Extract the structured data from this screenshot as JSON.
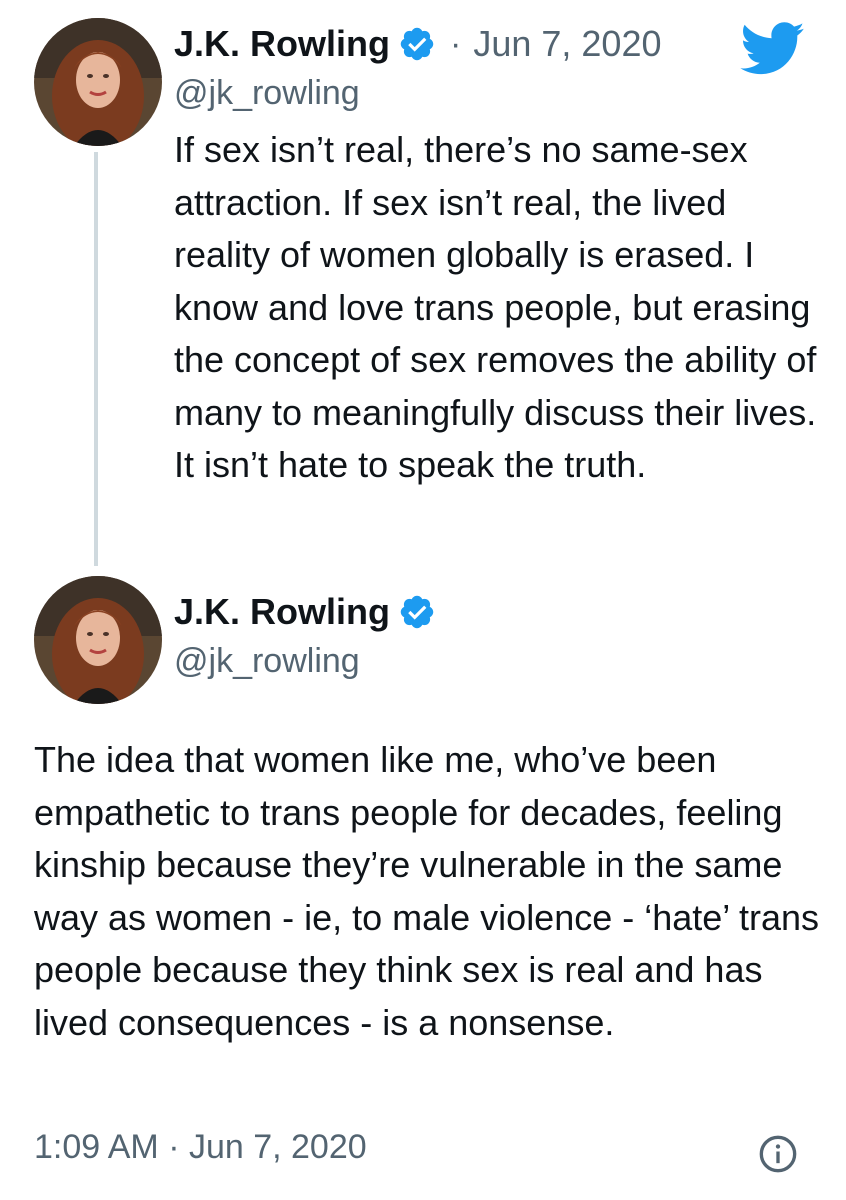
{
  "colors": {
    "accent": "#1d9bf0",
    "text_primary": "#0f1419",
    "text_secondary": "#536471",
    "thread_line": "#cfd9de"
  },
  "icons": {
    "twitter_logo": "twitter-bird-icon",
    "verified": "verified-badge-icon",
    "info": "info-icon"
  },
  "tweet1": {
    "author_name": "J.K. Rowling",
    "handle": "@jk_rowling",
    "separator": "·",
    "date": "Jun 7, 2020",
    "text": "If sex isn’t real, there’s no same-sex attraction. If sex isn’t real, the lived reality of women globally is erased. I know and love trans people, but erasing the concept of sex removes the ability of many to meaningfully discuss their lives. It isn’t hate to speak the truth."
  },
  "tweet2": {
    "author_name": "J.K. Rowling",
    "handle": "@jk_rowling",
    "text": "The idea that women like me, who’ve been empathetic to trans people for decades, feeling kinship because they’re vulnerable in the same way as women - ie, to male violence - ‘hate’ trans people because they think sex is real and has lived consequences - is a nonsense.",
    "timestamp": "1:09 AM · Jun 7, 2020"
  }
}
